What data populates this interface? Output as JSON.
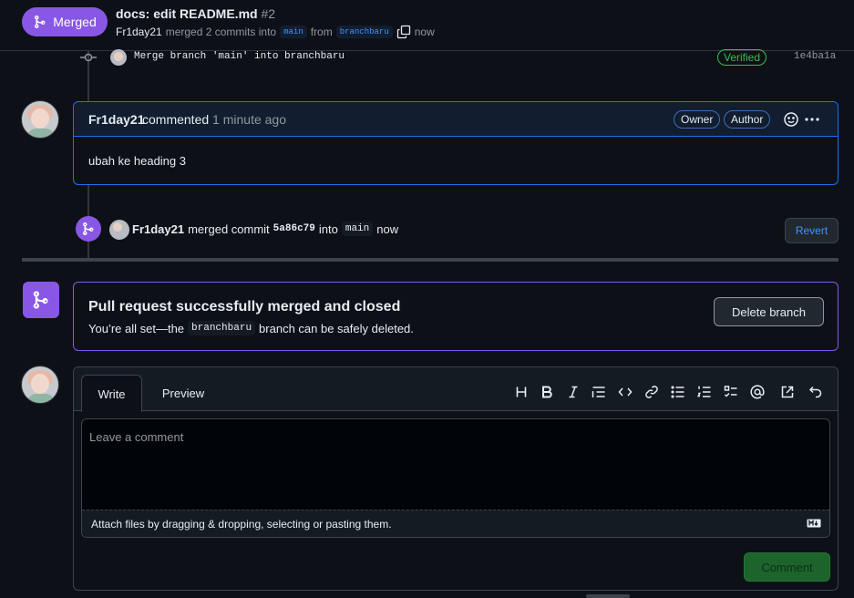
{
  "header": {
    "status": "Merged",
    "title": "docs: edit README.md",
    "number": "#2",
    "author": "Fr1day21",
    "merged_text": "merged 2 commits into",
    "base_branch": "main",
    "from_text": "from",
    "head_branch": "branchbaru",
    "time": "now"
  },
  "commit": {
    "message": "Merge branch 'main' into branchbaru",
    "verified": "Verified",
    "sha": "1e4ba1a"
  },
  "comment": {
    "author": "Fr1day21",
    "action": "commented",
    "time": "1 minute ago",
    "badge_owner": "Owner",
    "badge_author": "Author",
    "body": "ubah ke heading 3"
  },
  "merge_event": {
    "author": "Fr1day21",
    "verb": "merged commit",
    "sha": "5a86c79",
    "into": "into",
    "branch": "main",
    "time": "now",
    "revert_label": "Revert"
  },
  "merged_banner": {
    "title": "Pull request successfully merged and closed",
    "sub_prefix": "You’re all set—the",
    "branch": "branchbaru",
    "sub_suffix": "branch can be safely deleted.",
    "delete_label": "Delete branch"
  },
  "editor": {
    "tab_write": "Write",
    "tab_preview": "Preview",
    "placeholder": "Leave a comment",
    "attach_text": "Attach files by dragging & dropping, selecting or pasting them.",
    "submit_label": "Comment",
    "toolbar_icons": [
      "heading-icon",
      "bold-icon",
      "italic-icon",
      "quote-icon",
      "code-icon",
      "link-icon",
      "unordered-list-icon",
      "ordered-list-icon",
      "task-list-icon",
      "mention-icon",
      "reference-icon",
      "undo-icon"
    ]
  },
  "colors": {
    "merged_purple": "#8957e5",
    "accent_blue": "#1f6feb",
    "success_green": "#238636",
    "background": "#0d1117"
  }
}
